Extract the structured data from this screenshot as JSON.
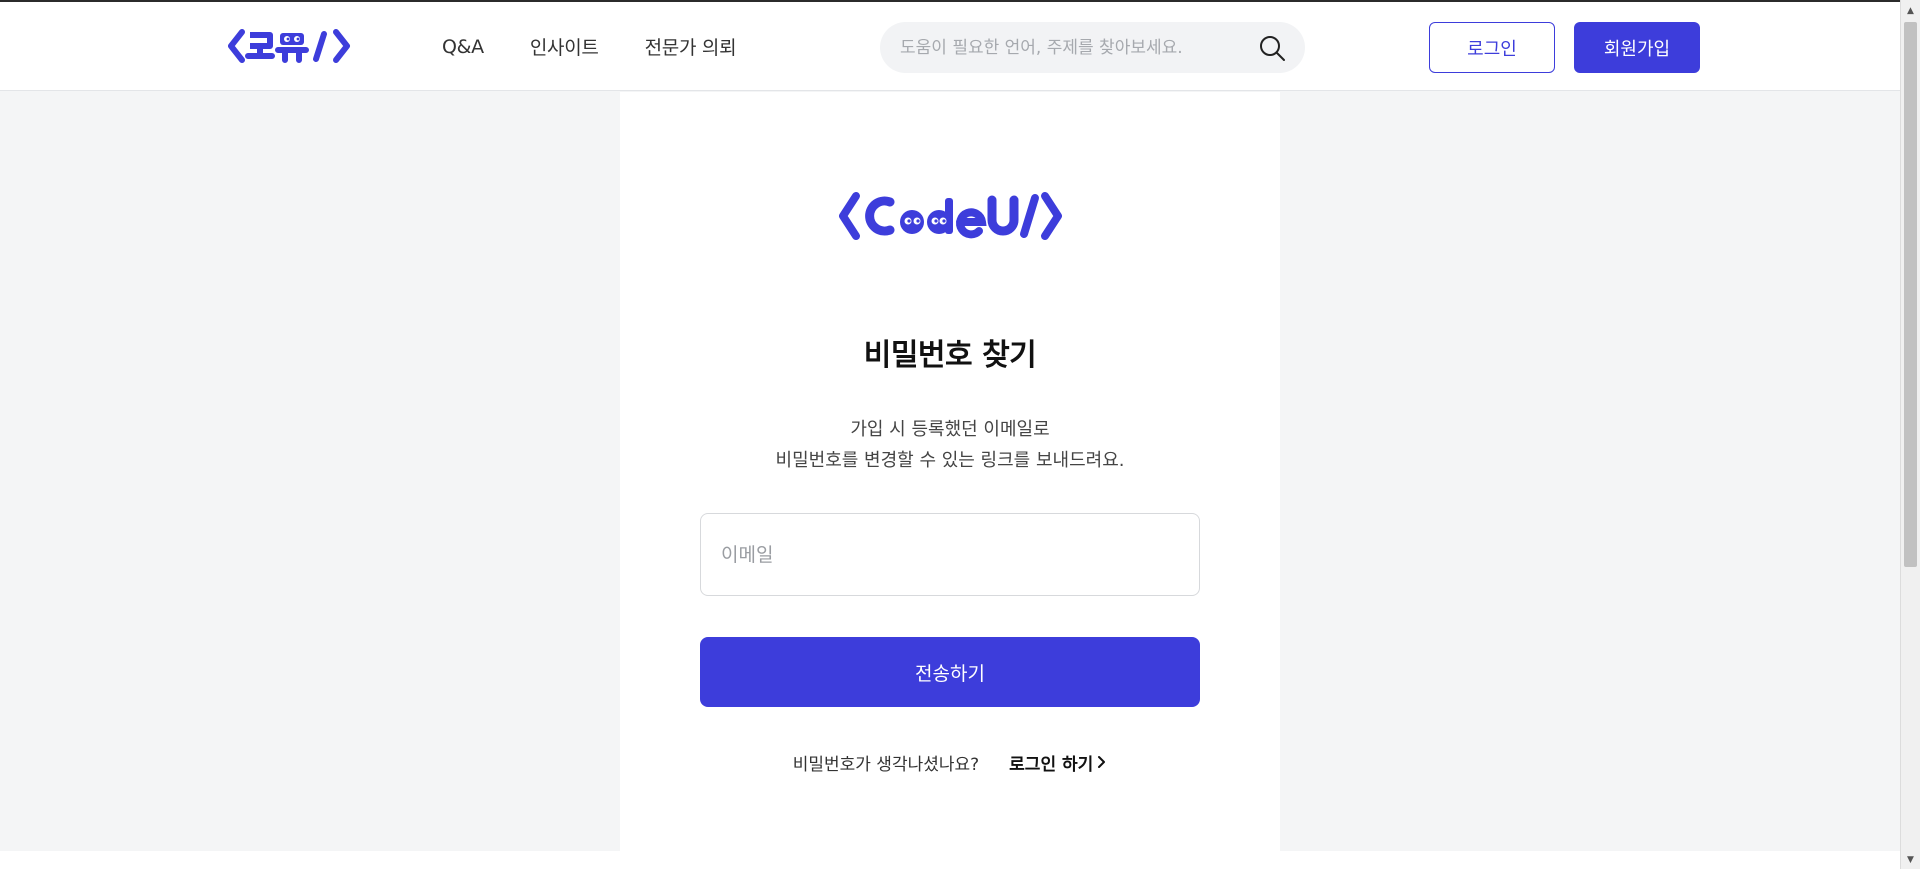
{
  "header": {
    "logo_text": "코뮤",
    "nav": [
      {
        "label": "Q&A"
      },
      {
        "label": "인사이트"
      },
      {
        "label": "전문가 의뢰"
      }
    ],
    "search": {
      "placeholder": "도움이 필요한 언어, 주제를 찾아보세요.",
      "value": ""
    },
    "login_label": "로그인",
    "signup_label": "회원가입"
  },
  "card": {
    "logo_text": "CodeU",
    "title": "비밀번호 찾기",
    "description_line1": "가입 시 등록했던 이메일로",
    "description_line2": "비밀번호를 변경할 수 있는 링크를 보내드려요.",
    "email": {
      "placeholder": "이메일",
      "value": ""
    },
    "submit_label": "전송하기",
    "remember_text": "비밀번호가 생각나셨나요?",
    "login_link_label": "로그인 하기"
  },
  "colors": {
    "brand": "#3d3ddb",
    "page_bg": "#f4f5f6",
    "card_bg": "#ffffff"
  },
  "icons": {
    "search": "search-icon",
    "chevron": "chevron-right-icon",
    "scroll_up": "arrow-up-icon",
    "scroll_down": "arrow-down-icon"
  }
}
